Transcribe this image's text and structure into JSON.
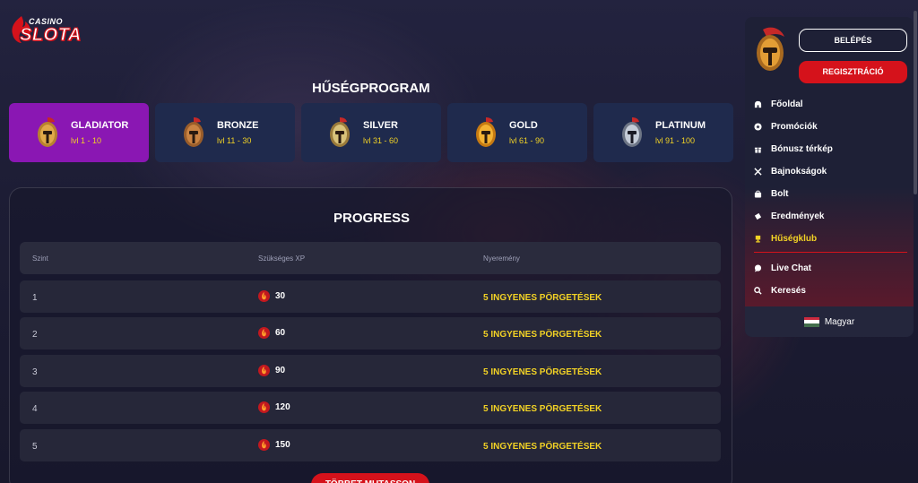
{
  "brand": {
    "casino": "CASINO",
    "name": "SLOTA"
  },
  "page_title": "HŰSÉGPROGRAM",
  "tiers": [
    {
      "name": "GLADIATOR",
      "levels": "lvl 1 - 10",
      "active": true
    },
    {
      "name": "BRONZE",
      "levels": "lvl 11 - 30",
      "active": false
    },
    {
      "name": "SILVER",
      "levels": "lvl 31 - 60",
      "active": false
    },
    {
      "name": "GOLD",
      "levels": "lvl 61 - 90",
      "active": false
    },
    {
      "name": "PLATINUM",
      "levels": "lvl 91 - 100",
      "active": false
    }
  ],
  "progress": {
    "title": "PROGRESS",
    "columns": [
      "Szint",
      "Szükséges XP",
      "Nyeremény"
    ],
    "rows": [
      {
        "level": "1",
        "xp": "30",
        "reward": "5 INGYENES PÖRGETÉSEK"
      },
      {
        "level": "2",
        "xp": "60",
        "reward": "5 INGYENES PÖRGETÉSEK"
      },
      {
        "level": "3",
        "xp": "90",
        "reward": "5 INGYENES PÖRGETÉSEK"
      },
      {
        "level": "4",
        "xp": "120",
        "reward": "5 INGYENES PÖRGETÉSEK"
      },
      {
        "level": "5",
        "xp": "150",
        "reward": "5 INGYENES PÖRGETÉSEK"
      }
    ],
    "more_button": "TÖBBET MUTASSON"
  },
  "sidebar": {
    "login": "BELÉPÉS",
    "register": "REGISZTRÁCIÓ",
    "menu": [
      {
        "label": "Főoldal",
        "icon": "helmet-icon"
      },
      {
        "label": "Promóciók",
        "icon": "star-badge-icon"
      },
      {
        "label": "Bónusz térkép",
        "icon": "gift-icon"
      },
      {
        "label": "Bajnokságok",
        "icon": "crossed-swords-icon"
      },
      {
        "label": "Bolt",
        "icon": "shop-bag-icon"
      },
      {
        "label": "Eredmények",
        "icon": "ticket-icon"
      },
      {
        "label": "Hűségklub",
        "icon": "trophy-icon",
        "active": true
      },
      {
        "label": "Live Chat",
        "icon": "chat-bubble-icon"
      },
      {
        "label": "Keresés",
        "icon": "search-icon"
      }
    ],
    "language": "Magyar"
  },
  "colors": {
    "accent_red": "#d5121b",
    "active_tier": "#8a17b3",
    "gold_text": "#f2d225",
    "tier_card": "#1f2a4d"
  }
}
